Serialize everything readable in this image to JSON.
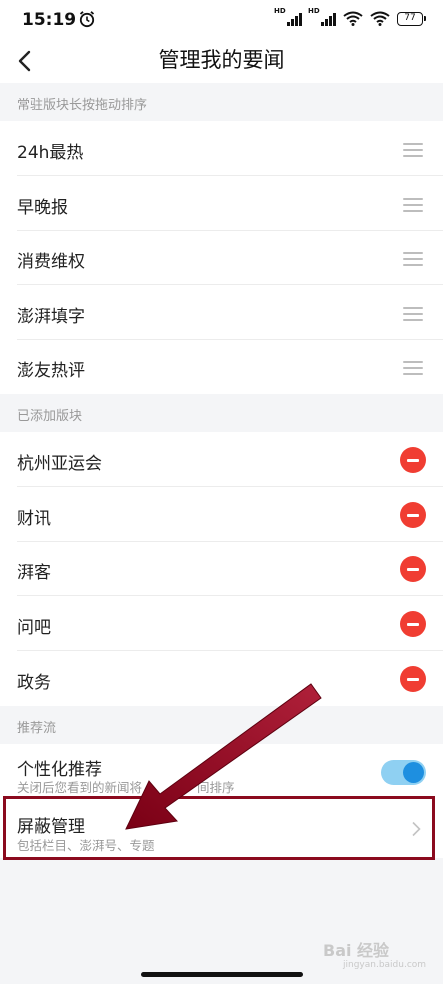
{
  "status_bar": {
    "time": "15:19",
    "network_label": "HD",
    "battery": "77"
  },
  "nav": {
    "title": "管理我的要闻"
  },
  "sections": {
    "pinned_header": "常驻版块长按拖动排序",
    "added_header": "已添加版块",
    "feed_header": "推荐流"
  },
  "pinned_items": [
    "24h最热",
    "早晚报",
    "消费维权",
    "澎湃填字",
    "澎友热评"
  ],
  "added_items": [
    "杭州亚运会",
    "财讯",
    "湃客",
    "问吧",
    "政务"
  ],
  "feed": {
    "personalized": {
      "title": "个性化推荐",
      "subtitle": "关闭后您看到的新闻将",
      "subtitle_tail": "间排序",
      "enabled": true
    },
    "block_manage": {
      "title": "屏蔽管理",
      "subtitle": "包括栏目、澎湃号、专题"
    }
  },
  "watermark": {
    "brand": "Bai 经验",
    "url": "jingyan.baidu.com"
  },
  "colors": {
    "accent_blue": "#1e8fe0",
    "remove_red": "#f03d32",
    "annotation": "#8b0a1e"
  }
}
